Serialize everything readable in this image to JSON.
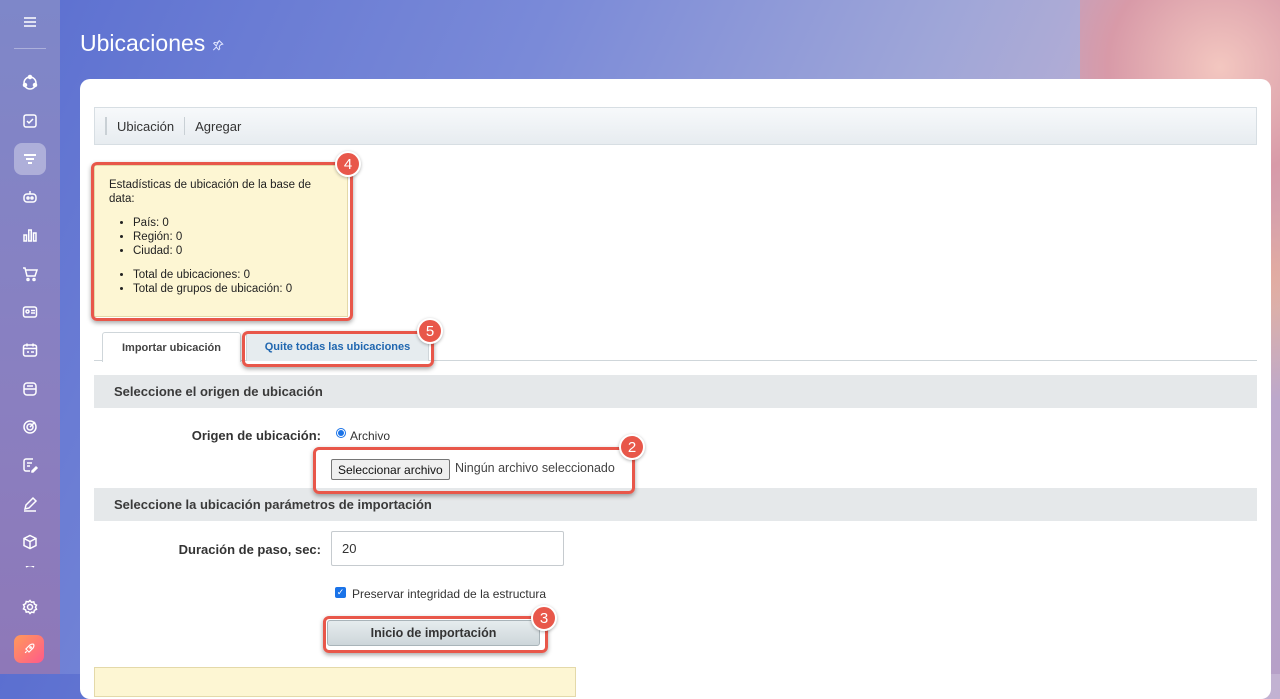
{
  "page": {
    "title": "Ubicaciones"
  },
  "sidebar": {
    "icons": [
      "menu-icon",
      "deals-icon",
      "tasks-icon",
      "filter-icon",
      "robot-icon",
      "chart-icon",
      "cart-icon",
      "contacts-icon",
      "calendar-icon",
      "inbox-icon",
      "target-icon",
      "edit-doc-icon",
      "pen-icon",
      "box-icon",
      "more-icon",
      "settings-icon",
      "rocket-icon"
    ]
  },
  "toolbar": {
    "location_label": "Ubicación",
    "add_label": "Agregar"
  },
  "stats": {
    "heading": "Estadísticas de ubicación de la base de data:",
    "group1": [
      "País: 0",
      "Región: 0",
      "Ciudad: 0"
    ],
    "group2": [
      "Total de ubicaciones: 0",
      "Total de grupos de ubicación: 0"
    ]
  },
  "tabs": [
    {
      "label": "Importar ubicación"
    },
    {
      "label": "Quite todas las ubicaciones"
    }
  ],
  "section1": {
    "title": "Seleccione el origen de ubicación"
  },
  "origin": {
    "label": "Origen de ubicación:",
    "option": "Archivo"
  },
  "file": {
    "button": "Seleccionar archivo",
    "status": "Ningún archivo seleccionado"
  },
  "section2": {
    "title": "Seleccione la ubicación parámetros de importación"
  },
  "step": {
    "label": "Duración de paso, sec:",
    "value": "20"
  },
  "preserve": {
    "label": "Preservar integridad de la estructura",
    "checked": true
  },
  "submit": {
    "label": "Inicio de importación"
  },
  "badges": {
    "b2": "2",
    "b3": "3",
    "b4": "4",
    "b5": "5"
  },
  "colors": {
    "highlight": "#e8574a",
    "accent": "#2067b0"
  }
}
